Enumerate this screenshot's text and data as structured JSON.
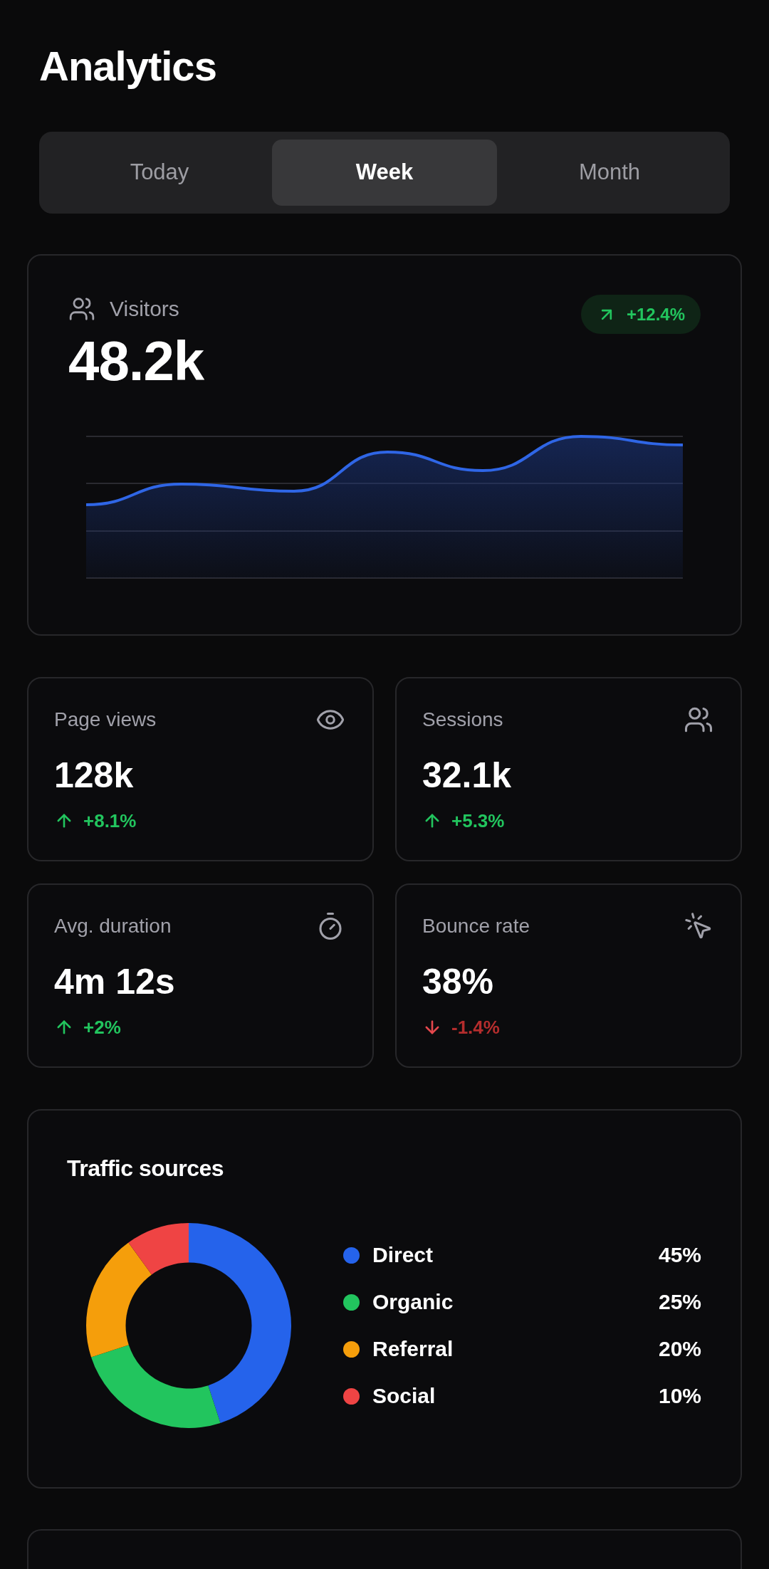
{
  "header": {
    "title": "Analytics"
  },
  "tabs": [
    {
      "label": "Today",
      "selected": false
    },
    {
      "label": "Week",
      "selected": true
    },
    {
      "label": "Month",
      "selected": false
    }
  ],
  "visitors": {
    "label": "Visitors",
    "value": "48.2k",
    "change": "+12.4%",
    "rising": true
  },
  "stats": [
    {
      "label": "Page views",
      "value": "128k",
      "change": "+8.1%",
      "rising": true
    },
    {
      "label": "Sessions",
      "value": "32.1k",
      "change": "+5.3%",
      "rising": true
    },
    {
      "label": "Avg. duration",
      "value": "4m 12s",
      "change": "+2%",
      "rising": true
    },
    {
      "label": "Bounce rate",
      "value": "38%",
      "change": "-1.4%",
      "rising": false
    }
  ],
  "traffic_sources": {
    "title": "Traffic sources",
    "chart_data": {
      "type": "donut",
      "values": [
        45,
        25,
        20,
        10
      ]
    },
    "legend": [
      {
        "label": "Direct",
        "value": "45%",
        "color": "#2563eb"
      },
      {
        "label": "Organic",
        "value": "25%",
        "color": "#22c55e"
      },
      {
        "label": "Referral",
        "value": "20%",
        "color": "#f59e0b"
      },
      {
        "label": "Social",
        "value": "10%",
        "color": "#ef4444"
      }
    ]
  }
}
